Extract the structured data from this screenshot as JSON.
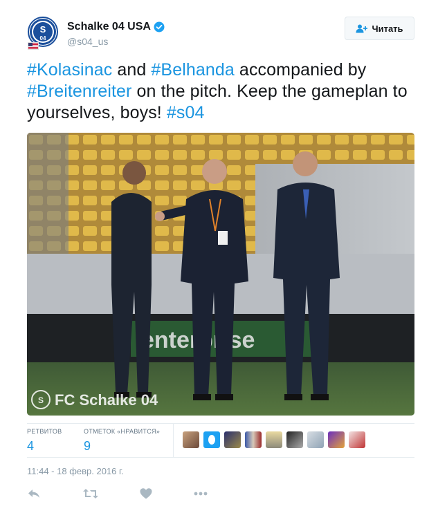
{
  "account": {
    "display_name": "Schalke 04 USA",
    "handle": "@s04_us",
    "verified": true,
    "avatar_icon": "schalke-crest",
    "flag_icon": "us-flag"
  },
  "follow_button": {
    "label": "Читать",
    "icon": "add-user-icon"
  },
  "tweet": {
    "segments": [
      {
        "text": "#Kolasinac",
        "type": "hashtag"
      },
      {
        "text": " and ",
        "type": "text"
      },
      {
        "text": "#Belhanda",
        "type": "hashtag"
      },
      {
        "text": " accompanied by ",
        "type": "text"
      },
      {
        "text": "#Breitenreiter",
        "type": "hashtag"
      },
      {
        "text": " on the pitch. Keep the gameplan to yourselves, boys! ",
        "type": "text"
      },
      {
        "text": "#s04",
        "type": "hashtag"
      }
    ]
  },
  "photo": {
    "watermark": "FC Schalke 04",
    "banner_text": "enterprise"
  },
  "stats": {
    "retweets_label": "РЕТВИТОВ",
    "retweets_value": "4",
    "likes_label": "ОТМЕТОК «НРАВИТСЯ»",
    "likes_value": "9",
    "liker_count": 9
  },
  "timestamp": "11:44 - 18 февр. 2016 г.",
  "actions": [
    {
      "name": "reply-icon"
    },
    {
      "name": "retweet-icon"
    },
    {
      "name": "like-icon"
    },
    {
      "name": "more-icon"
    }
  ],
  "colors": {
    "link": "#1b95e0",
    "text": "#14171a",
    "muted": "#8899a6",
    "verified": "#1da1f2",
    "schalke_blue": "#1b4f9c"
  }
}
